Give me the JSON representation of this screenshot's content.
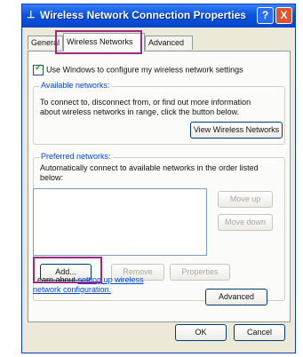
{
  "window": {
    "title": "Wireless Network Connection Properties",
    "help_label": "?",
    "close_label": "X",
    "app_icon": "network-icon"
  },
  "tabs": [
    {
      "label": "General"
    },
    {
      "label": "Wireless Networks"
    },
    {
      "label": "Advanced"
    }
  ],
  "use_windows": {
    "label": "Use Windows to configure my wireless network settings",
    "checked": true
  },
  "available": {
    "legend": "Available networks:",
    "text_line1": "To connect to, disconnect from, or find out more information",
    "text_line2": "about wireless networks in range, click the button below.",
    "button": "View Wireless Networks"
  },
  "preferred": {
    "legend": "Preferred networks:",
    "text_line1": "Automatically connect to available networks in the order listed",
    "text_line2": "below:",
    "move_up": "Move up",
    "move_down": "Move down",
    "add": "Add...",
    "remove": "Remove",
    "properties": "Properties"
  },
  "learn": {
    "prefix": "Learn about ",
    "link": "setting up wireless network configuration."
  },
  "advanced_button": "Advanced",
  "footer": {
    "ok": "OK",
    "cancel": "Cancel"
  },
  "highlight_color": "#9b2a82"
}
